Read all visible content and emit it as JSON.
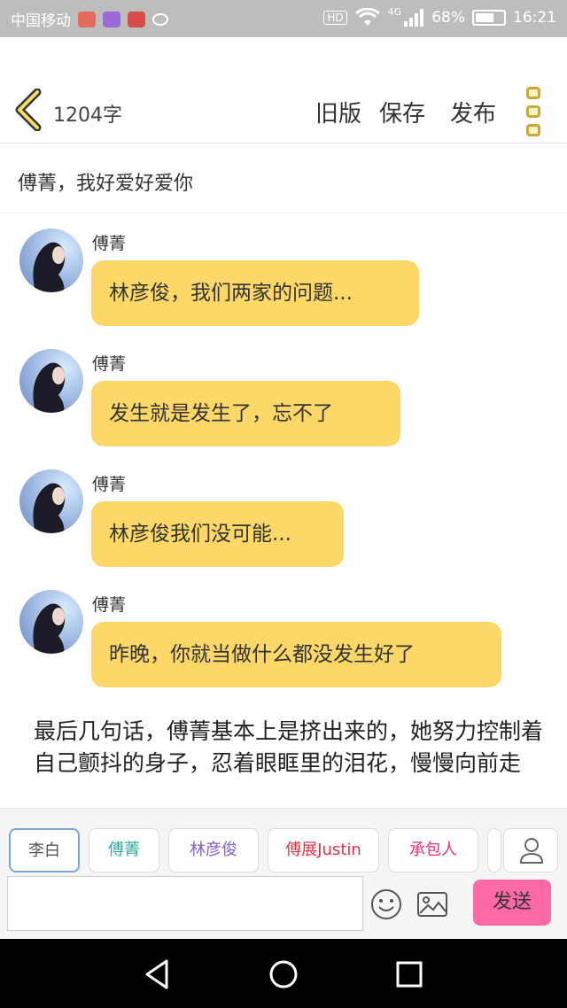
{
  "status_bar": {
    "carrier": "中国移动",
    "network_badge": "HD",
    "signal_type": "4G",
    "battery_percent": "68%",
    "battery_level": 0.68,
    "time": "16:21",
    "app_icon_colors": [
      "#e36a5c",
      "#9b6ad6",
      "#d84b4b",
      "#ffffff"
    ]
  },
  "toolbar": {
    "word_count": "1204字",
    "old_version_label": "旧版",
    "save_label": "保存",
    "publish_label": "发布",
    "accent_color": "#c6a93a"
  },
  "story_title": "傅菁，我好爱好爱你",
  "messages": [
    {
      "sender": "傅菁",
      "text": "林彦俊，我们两家的问题..."
    },
    {
      "sender": "傅菁",
      "text": "发生就是发生了，忘不了"
    },
    {
      "sender": "傅菁",
      "text": "林彦俊我们没可能..."
    },
    {
      "sender": "傅菁",
      "text": "昨晚，你就当做什么都没发生好了"
    }
  ],
  "narration": "最后几句话，傅菁基本上是挤出来的，她努力控制着自己颤抖的身子，忍着眼眶里的泪花，慢慢向前走",
  "characters": [
    {
      "name": "李白",
      "color": "#555555",
      "selected": true
    },
    {
      "name": "傅菁",
      "color": "#2aaa9a",
      "selected": false
    },
    {
      "name": "林彦俊",
      "color": "#8a5cc8",
      "selected": false
    },
    {
      "name": "傅展Justin",
      "color": "#d8344a",
      "selected": false
    },
    {
      "name": "承包人",
      "color": "#e0307a",
      "selected": false
    }
  ],
  "input": {
    "value": "",
    "placeholder": ""
  },
  "send_label": "发送",
  "icons": {
    "back": "back-chevron-icon",
    "menu": "more-menu-icon",
    "user": "user-icon",
    "emoji": "emoji-icon",
    "image": "image-icon",
    "nav_back": "nav-back-icon",
    "nav_home": "nav-home-icon",
    "nav_recent": "nav-recent-icon"
  },
  "colors": {
    "bubble": "#fdd767",
    "send_button": "#ff6aa6",
    "status_bar": "#bdbdbd"
  }
}
